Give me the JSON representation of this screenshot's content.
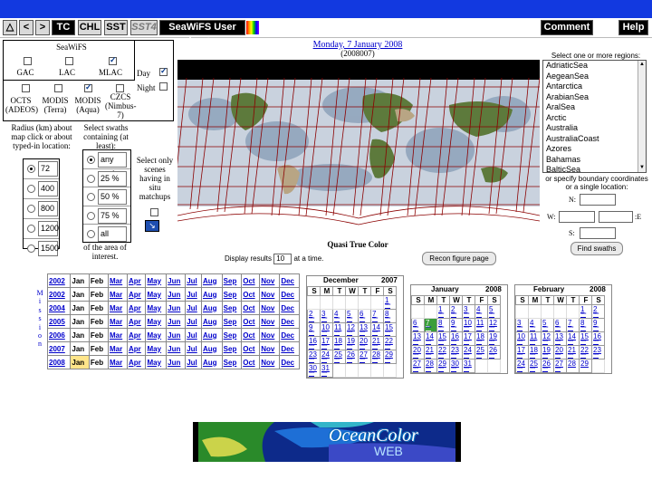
{
  "toolbar": {
    "buttons": [
      "△",
      "<",
      ">",
      "TC",
      "CHL",
      "SST",
      "SST4"
    ],
    "login": "SeaWiFS User Login",
    "comment": "Comment",
    "help": "Help"
  },
  "date": {
    "title": "Monday, 7 January 2008",
    "code": "(2008007)"
  },
  "sensors": {
    "seawifs": "SeaWiFS",
    "gac": "GAC",
    "lac": "LAC",
    "mlac": "MLAC",
    "octs": "OCTS (ADEOS)",
    "modis_terra": "MODIS (Terra)",
    "modis_aqua": "MODIS (Aqua)",
    "czcs": "CZCS (Nimbus-7)",
    "day": "Day",
    "night": "Night"
  },
  "radius": {
    "caption": "Radius (km) about map click or about typed-in location:",
    "options": [
      "72",
      "400",
      "800",
      "1200",
      "1500"
    ]
  },
  "swaths": {
    "caption": "Select swaths containing (at least):",
    "options": [
      "any part",
      "25 %",
      "50 %",
      "75 %",
      "all"
    ],
    "footer": "of the area of interest."
  },
  "scenes_note": "Select only scenes having in situ matchups",
  "map": {
    "caption": "Quasi True Color",
    "display_prefix": "Display results",
    "display_count": "10",
    "display_suffix": "at a time.",
    "recon_button": "Recon figure page"
  },
  "regions": {
    "caption": "Select one or more regions:",
    "items": [
      "AdriaticSea",
      "AegeanSea",
      "Antarctica",
      "ArabianSea",
      "AralSea",
      "Arctic",
      "Australia",
      "AustraliaCoast",
      "Azores",
      "Bahamas",
      "BalticSea"
    ],
    "boundary_caption": "or specify boundary coordinates or a single location:",
    "n": "N:",
    "w": "W:",
    "e": ":E",
    "s": "S:",
    "find_button": "Find swaths"
  },
  "year_table": {
    "months": [
      "Jan",
      "Feb",
      "Mar",
      "Apr",
      "May",
      "Jun",
      "Jul",
      "Aug",
      "Sep",
      "Oct",
      "Nov",
      "Dec"
    ],
    "rows": [
      "2002",
      "2002",
      "2004",
      "2005",
      "2006",
      "2007",
      "2008"
    ],
    "side_letters": [
      "M",
      "i",
      "s",
      "s",
      "i",
      "o",
      "n"
    ]
  },
  "calendars": {
    "weekdays": [
      "S",
      "M",
      "T",
      "W",
      "T",
      "F",
      "S"
    ],
    "december": {
      "month": "December",
      "year": "2007"
    },
    "january": {
      "month": "January",
      "year": "2008"
    },
    "february": {
      "month": "February",
      "year": "2008"
    }
  },
  "banner": {
    "text": "OceanColor",
    "subtext": "WEB"
  }
}
